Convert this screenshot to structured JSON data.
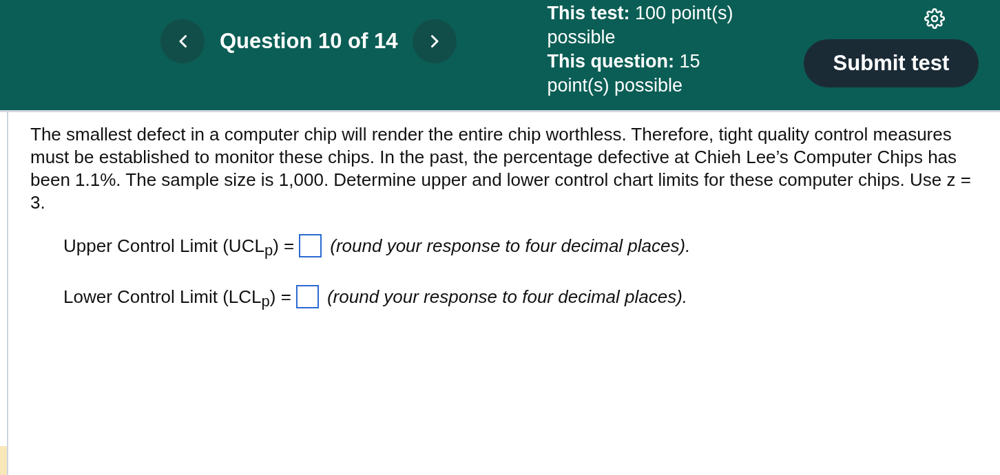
{
  "header": {
    "counter": "Question 10 of 14",
    "points": [
      "**This test:** 100 point(s) possible",
      "**This question:** 15 point(s) possible"
    ],
    "submit_button": "Submit test"
  },
  "question": {
    "text": "The smallest defect in a computer chip will render the entire chip worthless. Therefore, tight quality control measures must be established to monitor these chips. In the past, the percentage defective at Chieh Lee’s Computer Chips has been 1.1%. The sample size is 1,000. Determine upper and lower control chart limits for these computer chips. Use z = 3.",
    "answers": [
      {
        "label": "Upper Control Limit (UCL$_{p}$) =",
        "hint": "(round your response to four decimal places)."
      },
      {
        "label": "Lower Control Limit (LCL$_{p}$) =",
        "hint": "(round your response to four decimal places)."
      }
    ]
  }
}
